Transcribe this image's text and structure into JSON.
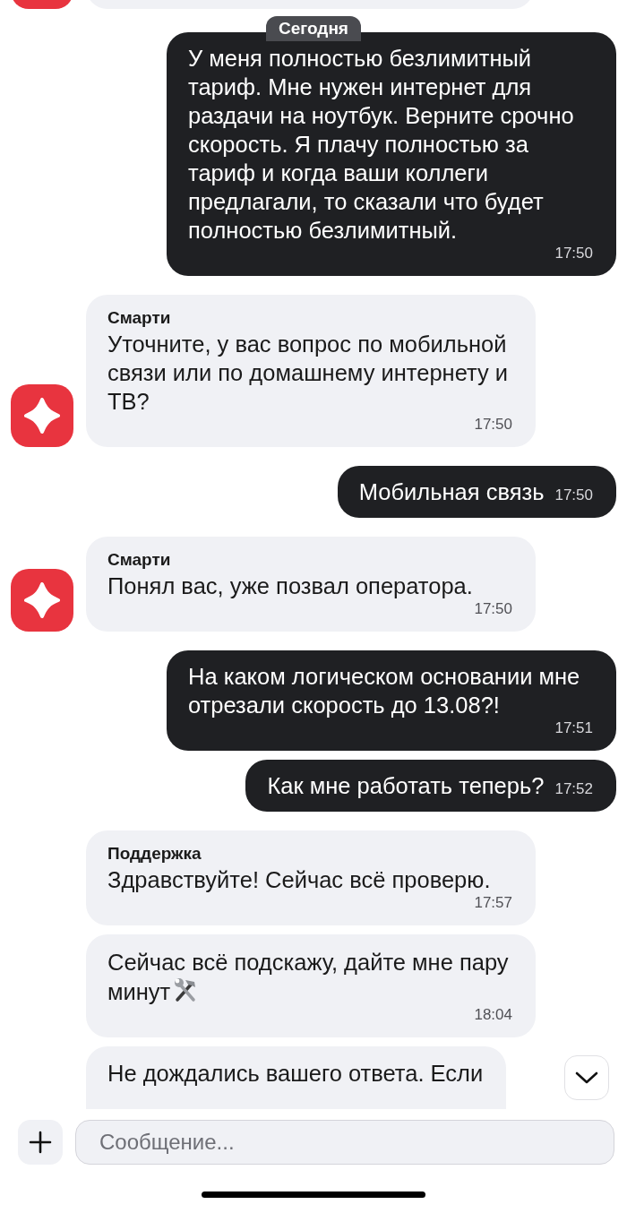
{
  "date_label": "Сегодня",
  "messages": [
    {
      "kind": "outgoing",
      "text": "У меня полностью безлимитный тариф. Мне нужен интернет для раздачи на ноутбук. Верните срочно скорость. Я плачу полностью за тариф и когда ваши коллеги предлагали, то сказали что будет полностью безлимитный.",
      "time": "17:50"
    },
    {
      "kind": "incoming",
      "sender": "Смарти",
      "text": "Уточните, у вас вопрос по мобильной связи или по домашнему интернету и ТВ?",
      "time": "17:50",
      "avatar": true
    },
    {
      "kind": "outgoing",
      "text": "Мобильная связь",
      "time": "17:50"
    },
    {
      "kind": "incoming",
      "sender": "Смарти",
      "text": "Понял вас, уже позвал оператора.",
      "time": "17:50",
      "avatar": true
    },
    {
      "kind": "outgoing",
      "text": "На каком логическом основании мне отрезали скорость до 13.08?!",
      "time": "17:51"
    },
    {
      "kind": "outgoing",
      "text": "Как мне работать теперь?",
      "time": "17:52"
    },
    {
      "kind": "incoming",
      "sender": "Поддержка",
      "text": "Здравствуйте! Сейчас всё проверю.",
      "time": "17:57"
    },
    {
      "kind": "incoming",
      "text": "Сейчас всё подскажу, дайте мне пару минут",
      "time": "18:04",
      "tools_emoji": true
    },
    {
      "kind": "incoming",
      "text": "Не дождались вашего ответа. Если"
    }
  ],
  "composer": {
    "placeholder": "Сообщение..."
  }
}
